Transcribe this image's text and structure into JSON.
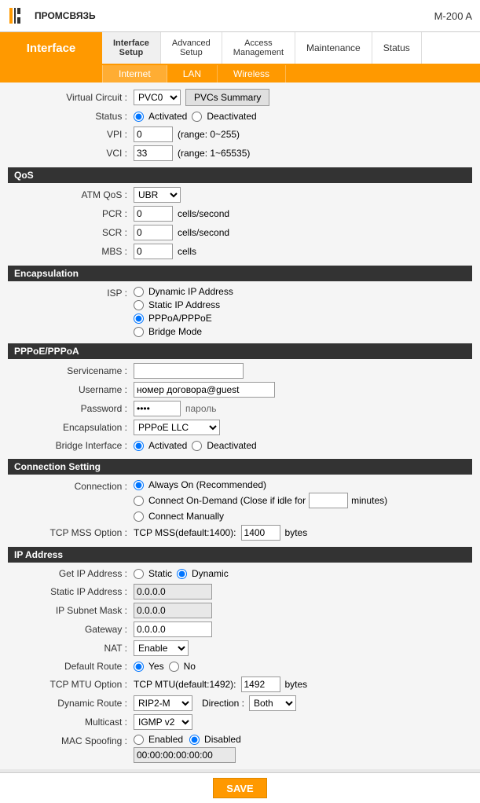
{
  "header": {
    "logo_text": "ПРОМСВЯЗЬ",
    "model": "M-200 A"
  },
  "nav": {
    "interface_label": "Interface",
    "tabs": [
      {
        "id": "interface-setup",
        "label": "Interface\nSetup",
        "active": true
      },
      {
        "id": "advanced-setup",
        "label": "Advanced\nSetup"
      },
      {
        "id": "access-management",
        "label": "Access\nManagement"
      },
      {
        "id": "maintenance",
        "label": "Maintenance"
      },
      {
        "id": "status",
        "label": "Status"
      }
    ],
    "sub_tabs": [
      {
        "id": "internet",
        "label": "Internet",
        "active": true
      },
      {
        "id": "lan",
        "label": "LAN"
      },
      {
        "id": "wireless",
        "label": "Wireless"
      }
    ]
  },
  "form": {
    "virtual_circuit_label": "Virtual Circuit :",
    "virtual_circuit_value": "PVC0",
    "pvcs_summary_btn": "PVCs Summary",
    "status_label": "Status :",
    "status_activated": "Activated",
    "status_deactivated": "Deactivated",
    "vpi_label": "VPI :",
    "vpi_value": "0",
    "vpi_range": "(range: 0~255)",
    "vci_label": "VCI :",
    "vci_value": "33",
    "vci_range": "(range: 1~65535)",
    "qos_section": "QoS",
    "atm_qos_label": "ATM QoS :",
    "atm_qos_value": "UBR",
    "pcr_label": "PCR :",
    "pcr_value": "0",
    "pcr_unit": "cells/second",
    "scr_label": "SCR :",
    "scr_value": "0",
    "scr_unit": "cells/second",
    "mbs_label": "MBS :",
    "mbs_value": "0",
    "mbs_unit": "cells",
    "encapsulation_section": "Encapsulation",
    "isp_label": "ISP :",
    "isp_dynamic": "Dynamic IP Address",
    "isp_static": "Static IP Address",
    "isp_pppoa": "PPPoA/PPPoE",
    "isp_bridge": "Bridge Mode",
    "pppoe_section": "PPPoE/PPPoA",
    "servicename_label": "Servicename :",
    "servicename_value": "",
    "username_label": "Username :",
    "username_value": "номер договора@guest",
    "password_label": "Password :",
    "password_dots": "••••",
    "password_hint": "пароль",
    "encapsulation_label": "Encapsulation :",
    "encapsulation_value": "PPPoE LLC",
    "bridge_interface_label": "Bridge Interface :",
    "bridge_activated": "Activated",
    "bridge_deactivated": "Deactivated",
    "connection_section": "Connection Setting",
    "connection_label": "Connection :",
    "always_on": "Always On (Recommended)",
    "connect_demand": "Connect On-Demand (Close if idle for",
    "demand_minutes": "",
    "demand_unit": "minutes)",
    "connect_manually": "Connect Manually",
    "tcp_mss_label": "TCP MSS Option :",
    "tcp_mss_text": "TCP MSS(default:1400):",
    "tcp_mss_value": "1400",
    "tcp_mss_unit": "bytes",
    "ip_section": "IP Address",
    "get_ip_label": "Get IP Address :",
    "get_ip_static": "Static",
    "get_ip_dynamic": "Dynamic",
    "static_ip_label": "Static IP Address :",
    "static_ip_value": "0.0.0.0",
    "subnet_mask_label": "IP Subnet Mask :",
    "subnet_mask_value": "0.0.0.0",
    "gateway_label": "Gateway :",
    "gateway_value": "0.0.0.0",
    "nat_label": "NAT :",
    "nat_value": "Enable",
    "default_route_label": "Default Route :",
    "default_route_yes": "Yes",
    "default_route_no": "No",
    "tcp_mtu_label": "TCP MTU Option :",
    "tcp_mtu_text": "TCP MTU(default:1492):",
    "tcp_mtu_value": "1492",
    "tcp_mtu_unit": "bytes",
    "dynamic_route_label": "Dynamic Route :",
    "dynamic_route_value": "RIP2-M",
    "direction_label": "Direction :",
    "direction_value": "Both",
    "multicast_label": "Multicast :",
    "multicast_value": "IGMP v2",
    "mac_spoofing_label": "MAC Spoofing :",
    "mac_enabled": "Enabled",
    "mac_disabled": "Disabled",
    "mac_address_value": "00:00:00:00:00:00",
    "save_btn": "SAVE"
  }
}
